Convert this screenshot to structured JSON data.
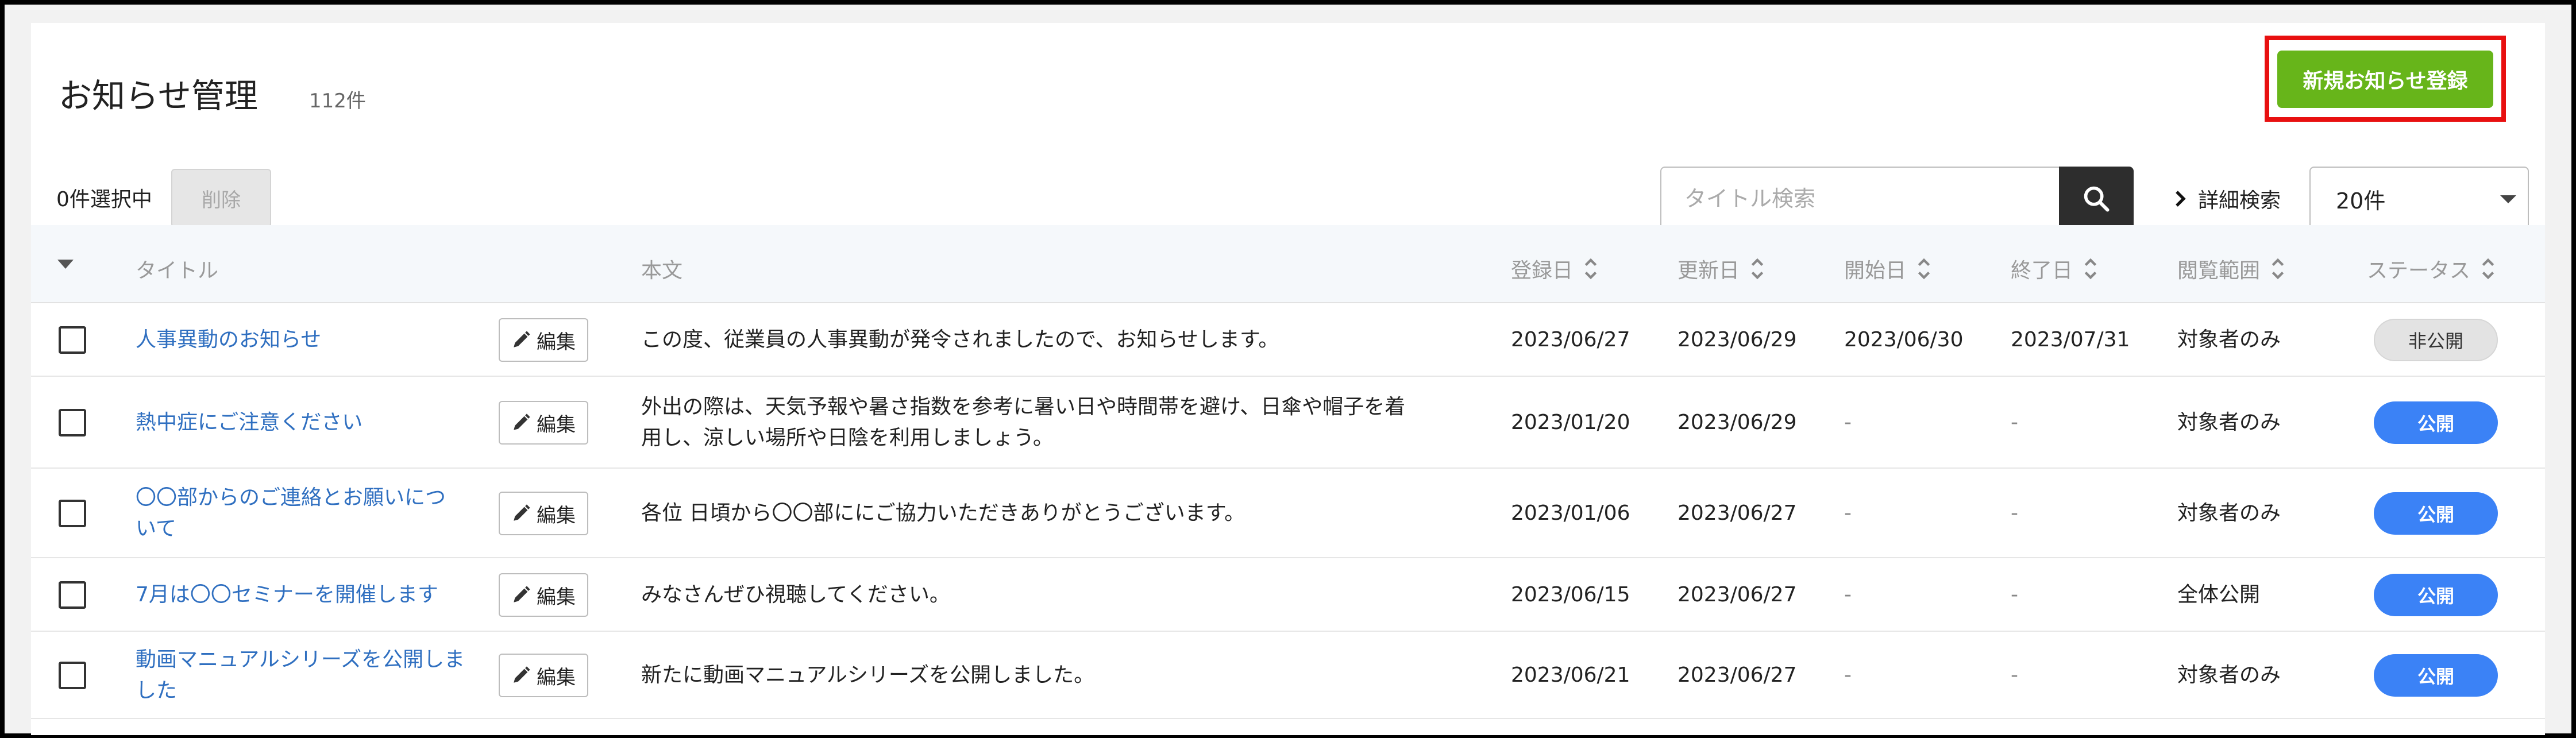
{
  "header": {
    "title": "お知らせ管理",
    "count": "112件",
    "new_button": "新規お知らせ登録"
  },
  "toolbar": {
    "selected": "0件選択中",
    "delete_button": "削除",
    "search_placeholder": "タイトル検索",
    "advanced_search": "詳細検索",
    "per_page": "20件"
  },
  "table": {
    "columns": {
      "title": "タイトル",
      "body": "本文",
      "registered": "登録日",
      "updated": "更新日",
      "start": "開始日",
      "end": "終了日",
      "scope": "閲覧範囲",
      "status": "ステータス"
    },
    "edit_label": "編集",
    "rows": [
      {
        "title_lines": [
          "人事異動のお知らせ"
        ],
        "body_lines": [
          "この度、従業員の人事異動が発令されましたので、お知らせします。"
        ],
        "registered": "2023/06/27",
        "updated": "2023/06/29",
        "start": "2023/06/30",
        "end": "2023/07/31",
        "scope": "対象者のみ",
        "status": "非公開"
      },
      {
        "title_lines": [
          "熱中症にご注意ください"
        ],
        "body_lines": [
          "外出の際は、天気予報や暑さ指数を参考に暑い日や時間帯を避け、日傘や帽子を着",
          "用し、涼しい場所や日陰を利用しましょう。"
        ],
        "registered": "2023/01/20",
        "updated": "2023/06/29",
        "start": "-",
        "end": "-",
        "scope": "対象者のみ",
        "status": "公開"
      },
      {
        "title_lines": [
          "〇〇部からのご連絡とお願いにつ",
          "いて"
        ],
        "body_lines": [
          "各位 日頃から〇〇部ににご協力いただきありがとうございます。"
        ],
        "registered": "2023/01/06",
        "updated": "2023/06/27",
        "start": "-",
        "end": "-",
        "scope": "対象者のみ",
        "status": "公開"
      },
      {
        "title_lines": [
          "7月は〇〇セミナーを開催します"
        ],
        "body_lines": [
          "みなさんぜひ視聴してください。"
        ],
        "registered": "2023/06/15",
        "updated": "2023/06/27",
        "start": "-",
        "end": "-",
        "scope": "全体公開",
        "status": "公開"
      },
      {
        "title_lines": [
          "動画マニュアルシリーズを公開しま",
          "した"
        ],
        "body_lines": [
          "新たに動画マニュアルシリーズを公開しました。"
        ],
        "registered": "2023/06/21",
        "updated": "2023/06/27",
        "start": "-",
        "end": "-",
        "scope": "対象者のみ",
        "status": "公開"
      }
    ]
  }
}
